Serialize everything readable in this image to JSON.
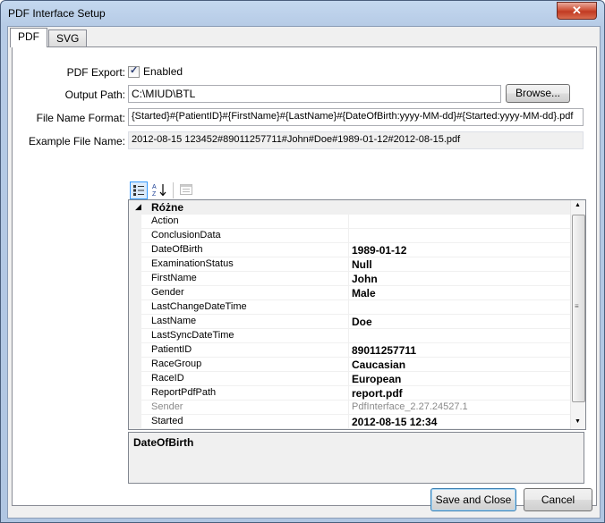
{
  "window": {
    "title": "PDF Interface Setup",
    "close_glyph": "✕"
  },
  "tabs": [
    {
      "label": "PDF"
    },
    {
      "label": "SVG"
    }
  ],
  "pdf_export": {
    "label": "PDF Export:",
    "checked": true,
    "checkbox_label": "Enabled"
  },
  "output_path": {
    "label": "Output Path:",
    "value": "C:\\MIUD\\BTL",
    "browse_label": "Browse..."
  },
  "file_name_format": {
    "label": "File Name Format:",
    "value": "{Started}#{PatientID}#{FirstName}#{LastName}#{DateOfBirth:yyyy-MM-dd}#{Started:yyyy-MM-dd}.pdf"
  },
  "example_file_name": {
    "label": "Example File Name:",
    "value": "2012-08-15 123452#89011257711#John#Doe#1989-01-12#2012-08-15.pdf"
  },
  "toolbar": {
    "categorized_icon": "categorized-icon",
    "alphabetical_icon": "alphabetical-icon",
    "pages_icon": "property-pages-icon"
  },
  "property_grid": {
    "category": "Różne",
    "rows": [
      {
        "name": "Action",
        "value": ""
      },
      {
        "name": "ConclusionData",
        "value": ""
      },
      {
        "name": "DateOfBirth",
        "value": "1989-01-12"
      },
      {
        "name": "ExaminationStatus",
        "value": "Null"
      },
      {
        "name": "FirstName",
        "value": "John"
      },
      {
        "name": "Gender",
        "value": "Male"
      },
      {
        "name": "LastChangeDateTime",
        "value": ""
      },
      {
        "name": "LastName",
        "value": "Doe"
      },
      {
        "name": "LastSyncDateTime",
        "value": ""
      },
      {
        "name": "PatientID",
        "value": "89011257711"
      },
      {
        "name": "RaceGroup",
        "value": "Caucasian"
      },
      {
        "name": "RaceID",
        "value": "European"
      },
      {
        "name": "ReportPdfPath",
        "value": "report.pdf"
      },
      {
        "name": "Sender",
        "value": "PdfInterface_2.27.24527.1",
        "readonly": true
      },
      {
        "name": "Started",
        "value": "2012-08-15 12:34"
      }
    ]
  },
  "help": {
    "title": "DateOfBirth"
  },
  "footer": {
    "save_label": "Save and Close",
    "cancel_label": "Cancel"
  }
}
